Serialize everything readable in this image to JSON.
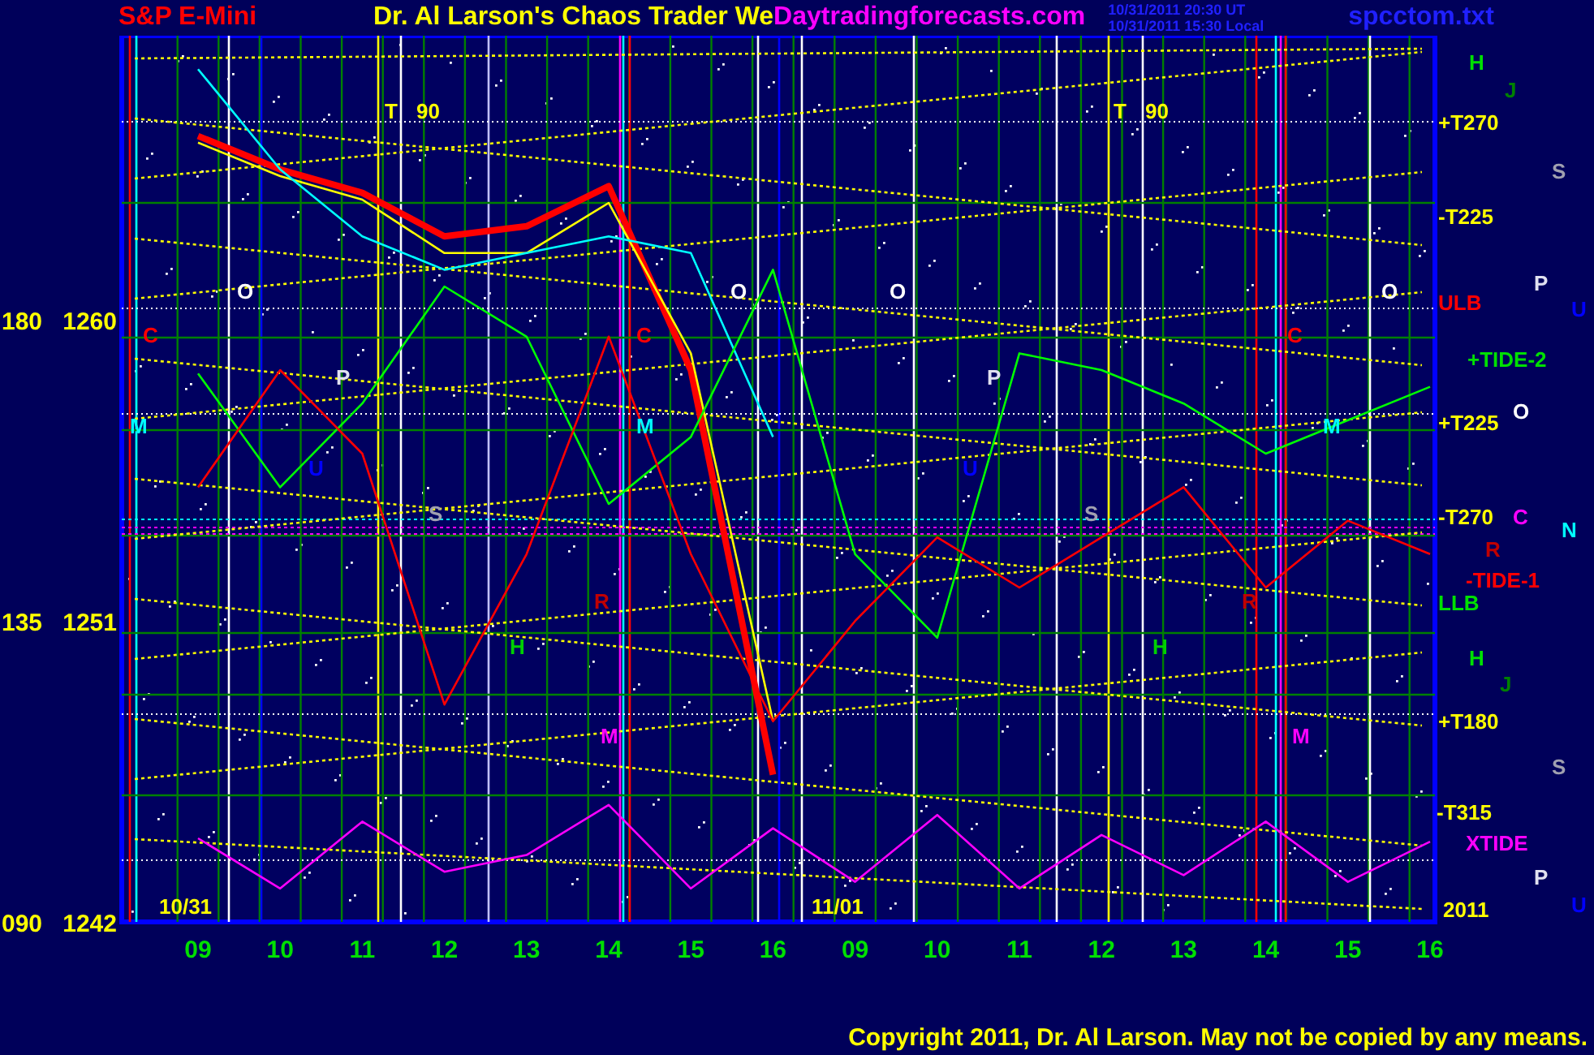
{
  "header": {
    "instrument": "S&P E-Mini",
    "title": "Dr. Al Larson's Chaos Trader We",
    "site": "Daytradingforecasts.com",
    "timestamps": [
      "10/31/2011 20:30 UT",
      "10/31/2011 15:30 Local"
    ],
    "file": "spcctom.txt"
  },
  "chart": {
    "chart_data": {
      "type": "line",
      "categories": [
        "09",
        "10",
        "11",
        "12",
        "13",
        "14",
        "15",
        "16",
        "09",
        "10",
        "11",
        "12",
        "13",
        "14",
        "15",
        "16"
      ],
      "yticks": [
        1242,
        1251,
        1260
      ],
      "ylim": [
        1242,
        1268.5
      ],
      "series": [
        {
          "color": "#ff0000",
          "values": [
            1265.5,
            1264.5,
            1263.8,
            1262.5,
            1262.8,
            1264.0,
            1258.5,
            1246.4,
            null,
            null,
            null,
            null,
            null,
            null,
            null,
            null
          ]
        },
        {
          "color": "#ffff00",
          "values": [
            1265.3,
            1264.3,
            1263.6,
            1262.0,
            1262.0,
            1263.5,
            1259.0,
            1248.0,
            null,
            null,
            null,
            null,
            null,
            null,
            null,
            null
          ]
        },
        {
          "color": "#00ffff",
          "values": [
            1267.5,
            1264.5,
            1262.5,
            1261.5,
            1262.0,
            1262.5,
            1262.0,
            1256.5,
            null,
            null,
            null,
            null,
            null,
            null,
            null,
            null
          ]
        },
        {
          "color": "#00ff00",
          "values": [
            1258.4,
            1255.0,
            1257.5,
            1261.0,
            1259.5,
            1254.5,
            1256.5,
            1261.5,
            1253.0,
            1250.5,
            1259.0,
            1258.5,
            1257.5,
            1256.0,
            1257.0,
            1258.0
          ]
        },
        {
          "color": "#ff0000",
          "values": [
            1255.0,
            1258.5,
            1256.0,
            1248.5,
            1253.0,
            1259.5,
            1253.0,
            1248.0,
            1251.0,
            1253.5,
            1252.0,
            1253.5,
            1255.0,
            1252.0,
            1254.0,
            1253.0
          ]
        },
        {
          "color": "#ff00ff",
          "values": [
            1244.5,
            1243.0,
            1245.0,
            1243.5,
            1244.0,
            1245.5,
            1243.0,
            1244.8,
            1243.2,
            1245.2,
            1243.0,
            1244.6,
            1243.4,
            1245.0,
            1243.2,
            1244.4
          ]
        }
      ]
    },
    "degree_labels": [
      "180",
      "135",
      "090"
    ],
    "markers": [
      {
        "text": "T 90",
        "color": "#ffff00"
      },
      {
        "text": "T 90",
        "color": "#ffff00"
      },
      {
        "text": "O",
        "color": "#ffffff"
      },
      {
        "text": "O",
        "color": "#ffffff"
      },
      {
        "text": "O",
        "color": "#ffffff"
      },
      {
        "text": "O",
        "color": "#ffffff"
      },
      {
        "text": "C",
        "color": "#ff0000"
      },
      {
        "text": "C",
        "color": "#ff0000"
      },
      {
        "text": "C",
        "color": "#ff0000"
      },
      {
        "text": "P",
        "color": "#e0e0f0"
      },
      {
        "text": "P",
        "color": "#e0e0f0"
      },
      {
        "text": "M",
        "color": "#00ffff"
      },
      {
        "text": "M",
        "color": "#00ffff"
      },
      {
        "text": "M",
        "color": "#00ffff"
      },
      {
        "text": "U",
        "color": "#0000ff"
      },
      {
        "text": "U",
        "color": "#0000ff"
      },
      {
        "text": "S",
        "color": "#a0a0b0"
      },
      {
        "text": "S",
        "color": "#a0a0b0"
      },
      {
        "text": "R",
        "color": "#c00000"
      },
      {
        "text": "R",
        "color": "#c00000"
      },
      {
        "text": "H",
        "color": "#00d000"
      },
      {
        "text": "H",
        "color": "#00d000"
      },
      {
        "text": "M",
        "color": "#ff00ff"
      },
      {
        "text": "M",
        "color": "#ff00ff"
      },
      {
        "text": "10/31",
        "color": "#ffff00"
      },
      {
        "text": "11/01",
        "color": "#ffff00"
      }
    ],
    "level_labels": [
      {
        "text": "H",
        "color": "#00e000"
      },
      {
        "text": "J",
        "color": "#008000"
      },
      {
        "text": "+T270",
        "color": "#ffff00"
      },
      {
        "text": "S",
        "color": "#a0a0b0"
      },
      {
        "text": "-T225",
        "color": "#ffff00"
      },
      {
        "text": "ULB",
        "color": "#ff0000"
      },
      {
        "text": "P",
        "color": "#e0e0f0"
      },
      {
        "text": "U",
        "color": "#0000ff"
      },
      {
        "text": "+TIDE-2",
        "color": "#00e000"
      },
      {
        "text": "O",
        "color": "#ffffff"
      },
      {
        "text": "+T225",
        "color": "#ffff00"
      },
      {
        "text": "-T270",
        "color": "#ffff00"
      },
      {
        "text": "C",
        "color": "#ff00ff"
      },
      {
        "text": "N",
        "color": "#00ffff"
      },
      {
        "text": "R",
        "color": "#c00000"
      },
      {
        "text": "-TIDE-1",
        "color": "#ff0000"
      },
      {
        "text": "LLB",
        "color": "#00e000"
      },
      {
        "text": "H",
        "color": "#00e000"
      },
      {
        "text": "J",
        "color": "#008000"
      },
      {
        "text": "+T180",
        "color": "#ffff00"
      },
      {
        "text": "S",
        "color": "#a0a0b0"
      },
      {
        "text": "-T315",
        "color": "#ffff00"
      },
      {
        "text": "XTIDE",
        "color": "#ff00ff"
      },
      {
        "text": "P",
        "color": "#e0e0f0"
      },
      {
        "text": "2011",
        "color": "#ffff00"
      },
      {
        "text": "U",
        "color": "#0000ff"
      }
    ]
  },
  "copyright": "Copyright 2011, Dr. Al Larson. May not be copied by any means."
}
